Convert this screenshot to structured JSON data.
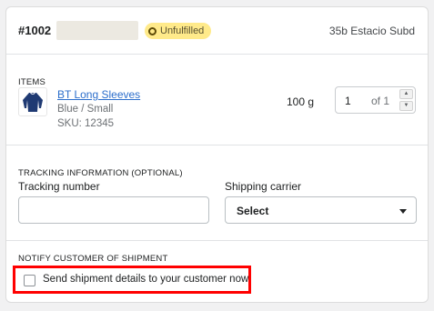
{
  "header": {
    "order_number": "#1002",
    "status_badge": "Unfulfilled",
    "location": "35b Estacio Subd"
  },
  "items_section": {
    "title": "ITEMS",
    "product": {
      "icon": "long-sleeve-shirt-icon",
      "name": "BT Long Sleeves",
      "variant": "Blue / Small",
      "sku": "SKU: 12345",
      "weight": "100 g",
      "quantity": "1",
      "quantity_of": "of 1"
    }
  },
  "tracking_section": {
    "title": "TRACKING INFORMATION (OPTIONAL)",
    "tracking_label": "Tracking number",
    "tracking_value": "",
    "tracking_placeholder": "",
    "carrier_label": "Shipping carrier",
    "carrier_selected": "Select"
  },
  "notify_section": {
    "title": "NOTIFY CUSTOMER OF SHIPMENT",
    "checkbox_label": "Send shipment details to your customer now",
    "checked": false
  },
  "colors": {
    "badge_background": "#ffea8a",
    "link": "#2c6ecb",
    "highlight": "#ff0000",
    "shirt": "#1f3a73"
  }
}
